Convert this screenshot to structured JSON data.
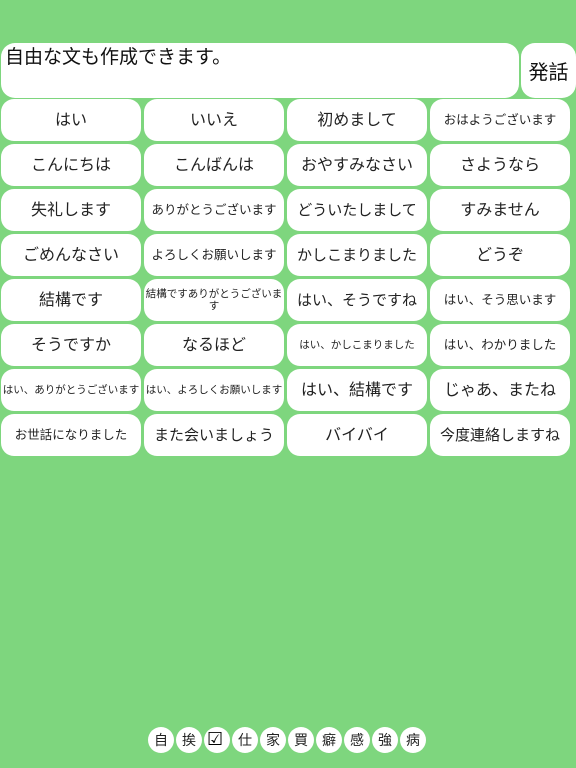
{
  "input": {
    "text": "自由な文も作成できます。"
  },
  "speak_button": {
    "label": "発話"
  },
  "phrases": [
    "はい",
    "いいえ",
    "初めまして",
    "おはようございます",
    "こんにちは",
    "こんばんは",
    "おやすみなさい",
    "さようなら",
    "失礼します",
    "ありがとうございます",
    "どういたしまして",
    "すみません",
    "ごめんなさい",
    "よろしくお願いします",
    "かしこまりました",
    "どうぞ",
    "結構です",
    "結構ですありがとうございます",
    "はい、そうですね",
    "はい、そう思います",
    "そうですか",
    "なるほど",
    "はい、かしこまりました",
    "はい、わかりました",
    "はい、ありがとうございます",
    "はい、よろしくお願いします",
    "はい、結構です",
    "じゃあ、またね",
    "お世話になりました",
    "また会いましょう",
    "バイバイ",
    "今度連絡しますね"
  ],
  "tabs": [
    "自",
    "挨",
    "",
    "仕",
    "家",
    "買",
    "癖",
    "感",
    "強",
    "病"
  ],
  "selected_tab_index": 2,
  "selected_tab_icon": "checkmark-icon"
}
